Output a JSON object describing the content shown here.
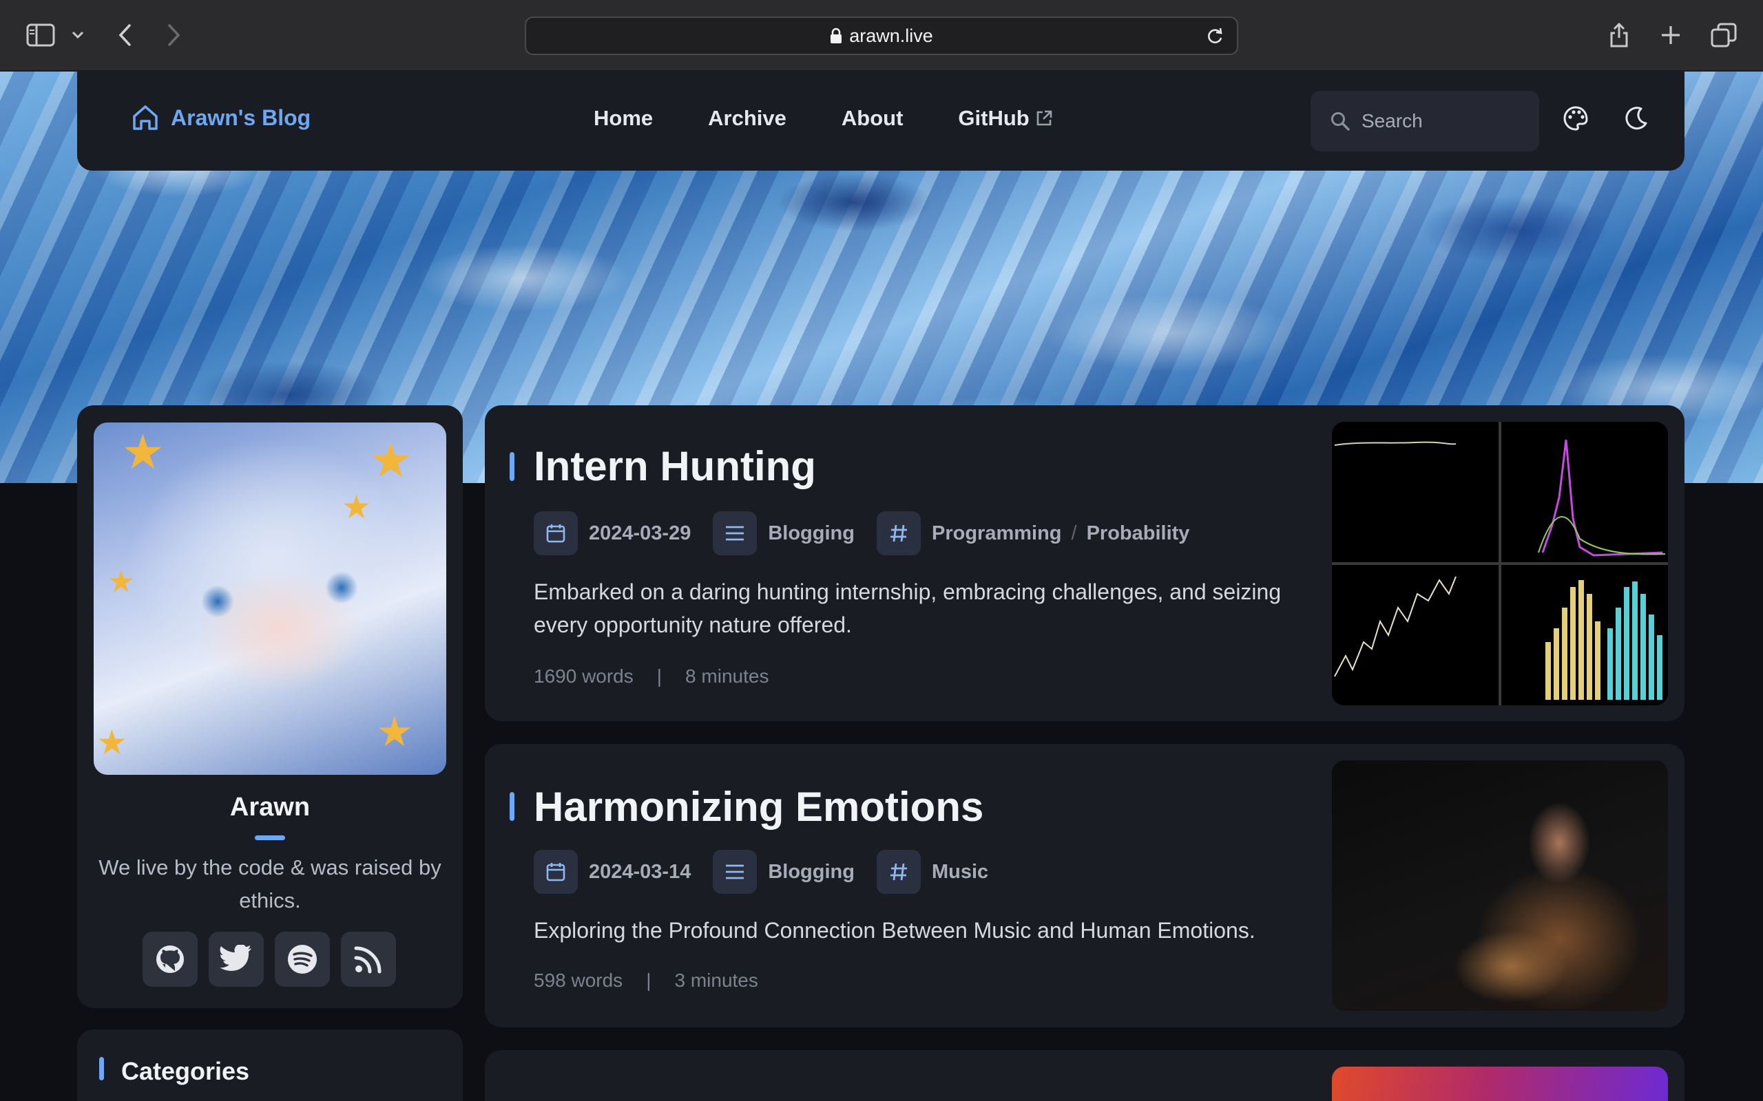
{
  "browser": {
    "url": "arawn.live"
  },
  "nav": {
    "brand": "Arawn's Blog",
    "links": [
      "Home",
      "Archive",
      "About",
      "GitHub"
    ],
    "search_placeholder": "Search"
  },
  "profile": {
    "name": "Arawn",
    "bio": "We live by the code & was raised by ethics.",
    "socials": [
      "github-icon",
      "twitter-icon",
      "spotify-icon",
      "rss-icon"
    ]
  },
  "categories": {
    "title": "Categories"
  },
  "posts": [
    {
      "title": "Intern Hunting",
      "date": "2024-03-29",
      "category": "Blogging",
      "tags": [
        "Programming",
        "Probability"
      ],
      "tag_separator": "/",
      "description": "Embarked on a daring hunting internship, embracing challenges, and seizing every opportunity nature offered.",
      "words": "1690 words",
      "minutes": "8 minutes",
      "stats_separator": "|"
    },
    {
      "title": "Harmonizing Emotions",
      "date": "2024-03-14",
      "category": "Blogging",
      "tags": [
        "Music"
      ],
      "description": "Exploring the Profound Connection Between Music and Human Emotions.",
      "words": "598 words",
      "minutes": "3 minutes",
      "stats_separator": "|"
    }
  ],
  "colors": {
    "accent": "#6ea8f5",
    "card": "#1a1c23",
    "background": "#0d0f14"
  }
}
